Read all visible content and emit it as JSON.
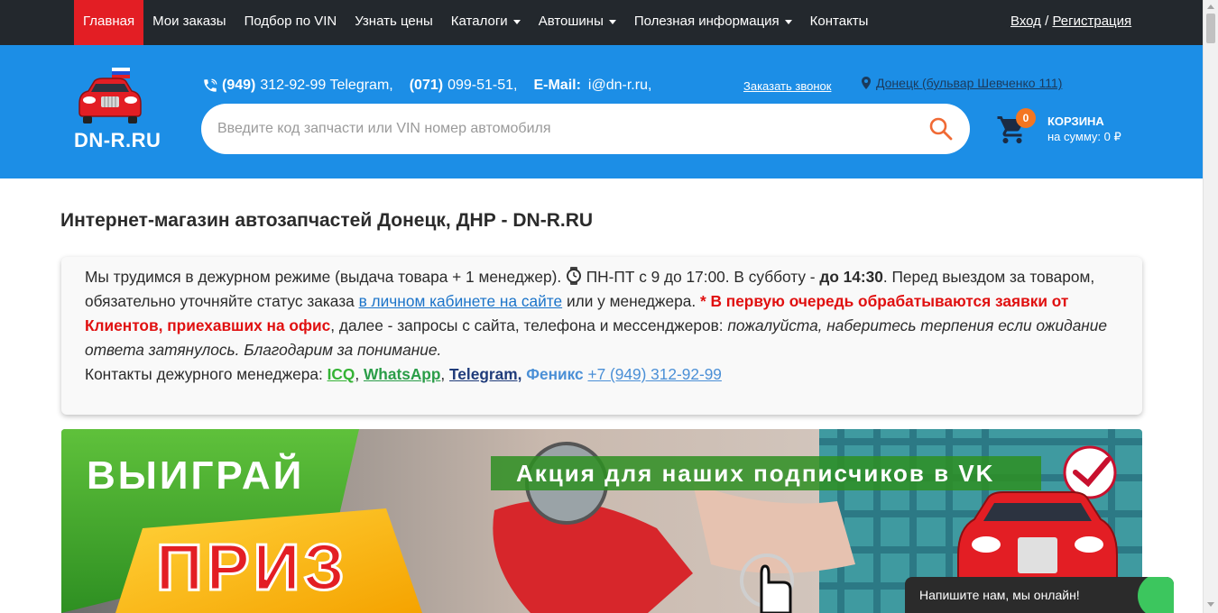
{
  "nav": {
    "items": [
      {
        "label": "Главная",
        "active": true,
        "dropdown": false
      },
      {
        "label": "Мои заказы",
        "active": false,
        "dropdown": false
      },
      {
        "label": "Подбор по VIN",
        "active": false,
        "dropdown": false
      },
      {
        "label": "Узнать цены",
        "active": false,
        "dropdown": false
      },
      {
        "label": "Каталоги",
        "active": false,
        "dropdown": true
      },
      {
        "label": "Автошины",
        "active": false,
        "dropdown": true
      },
      {
        "label": "Полезная информация",
        "active": false,
        "dropdown": true
      },
      {
        "label": "Контакты",
        "active": false,
        "dropdown": false
      }
    ],
    "login": "Вход",
    "separator": "/",
    "register": "Регистрация"
  },
  "header": {
    "logo_text": "DN-R.RU",
    "phone1_code": "(949)",
    "phone1_number": "312-92-99 Telegram,",
    "phone2_code": "(071)",
    "phone2_number": "099-51-51,",
    "email_label": "E-Mail:",
    "email": "i@dn-r.ru,",
    "callback": "Заказать звонок",
    "address": "Донецк (бульвар Шевченко 111)",
    "search_placeholder": "Введите код запчасти или VIN номер автомобиля",
    "cart_count": "0",
    "cart_title": "КОРЗИНА",
    "cart_sum": "на сумму: 0 ₽"
  },
  "main": {
    "title": "Интернет-магазин автозапчастей Донецк, ДНР - DN-R.RU",
    "notice": {
      "p1": "Мы трудимся в дежурном режиме (выдача товара + 1 менеджер).",
      "p2": "ПН-ПТ с 9 до 17:00. В субботу -",
      "p3": "до 14:30",
      "p4": ". Перед выездом за товаром, обязательно уточняйте статус заказа",
      "link": "в личном кабинете на сайте",
      "p5": "или у менеджера.",
      "red": "* В первую очередь обрабатываются заявки от Клиентов, приехавших на офис",
      "p6": ", далее - запросы с сайта, телефона и мессенджеров:",
      "italic": "пожалуйста, наберитесь терпения если ожидание ответа затянулось. Благодарим за понимание.",
      "contacts_label": "Контакты дежурного менеджера:",
      "icq": "ICQ",
      "comma": ",",
      "whatsapp": "WhatsApp",
      "telegram": "Telegram,",
      "fenix": "Феникс",
      "phone": "+7 (949) 312-92-99"
    }
  },
  "banner": {
    "left_title": "ВЫИГРАЙ",
    "prize": "ПРИЗ",
    "right_title": "Акция для наших подписчиков в VK"
  },
  "chat": {
    "label": "Напишите нам, мы онлайн!"
  },
  "colors": {
    "topbar": "#23282d",
    "active_nav": "#e31e24",
    "header": "#1c8ee6",
    "badge": "#f47621",
    "accent_red": "#e01010"
  }
}
